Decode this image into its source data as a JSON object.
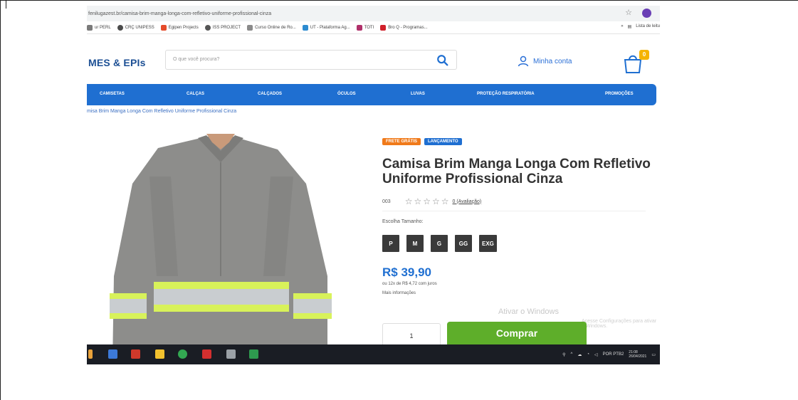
{
  "browser": {
    "url": "fenilugazest.br/camisa-brim-manga-longa-com-refletivo-uniforme-profissional-cinza",
    "bookmarks": [
      {
        "label": "ur PERL",
        "color": "#7a7a7a"
      },
      {
        "label": "CRÇ UNIPESS",
        "color": "#4b4b4b"
      },
      {
        "label": "Egipen Projects",
        "color": "#e54b2a"
      },
      {
        "label": "ISS PROJECT",
        "color": "#555555"
      },
      {
        "label": "Curso Online de Ro...",
        "color": "#8a8a8a"
      },
      {
        "label": "UT - Plataforma Ag...",
        "color": "#2d8bd0"
      },
      {
        "label": "TOTI",
        "color": "#b0306a"
      },
      {
        "label": "Bro Q - Programas...",
        "color": "#d0202a"
      }
    ],
    "bookmarks_right": "Lista de leitu"
  },
  "header": {
    "logo": "MES & EPIs",
    "search_placeholder": "O que você procura?",
    "account_label": "Minha conta",
    "cart_count": "0"
  },
  "nav": {
    "items": [
      "CAMISETAS",
      "CALÇAS",
      "CALÇADOS",
      "ÓCULOS",
      "LUVAS",
      "PROTEÇÃO RESPIRATÓRIA",
      "PROMOÇÕES"
    ]
  },
  "breadcrumb": "misa Brim Manga Longa Com Refletivo Uniforme Profissional Cinza",
  "product": {
    "badges": [
      {
        "label": "FRETE GRÁTIS",
        "color": "#f07a1a"
      },
      {
        "label": "LANÇAMENTO",
        "color": "#1f6fd1"
      }
    ],
    "title": "Camisa Brim Manga Longa Com Refletivo Uniforme Profissional Cinza",
    "sku": "003",
    "rating": 0,
    "stars_max": 5,
    "reviews_label": "0 (Avaliação)",
    "size_label": "Escolha Tamanho:",
    "sizes": [
      "P",
      "M",
      "G",
      "GG",
      "EXG"
    ],
    "price": "R$ 39,90",
    "installments": "ou 12x de R$ 4,72 com juros",
    "more_info": "Mais informações",
    "quantity": "1",
    "buy_label": "Comprar"
  },
  "watermark": {
    "line1": "Ativar o Windows",
    "line2": "Acesse Configurações para ativar o Windows."
  },
  "taskbar": {
    "tray_lang": "POR PTB2",
    "time": "21:08",
    "date": "26/04/2021"
  },
  "colors": {
    "brand_blue": "#1f6fd1",
    "buy_green": "#5eae2a",
    "cart_badge": "#f5b400"
  }
}
